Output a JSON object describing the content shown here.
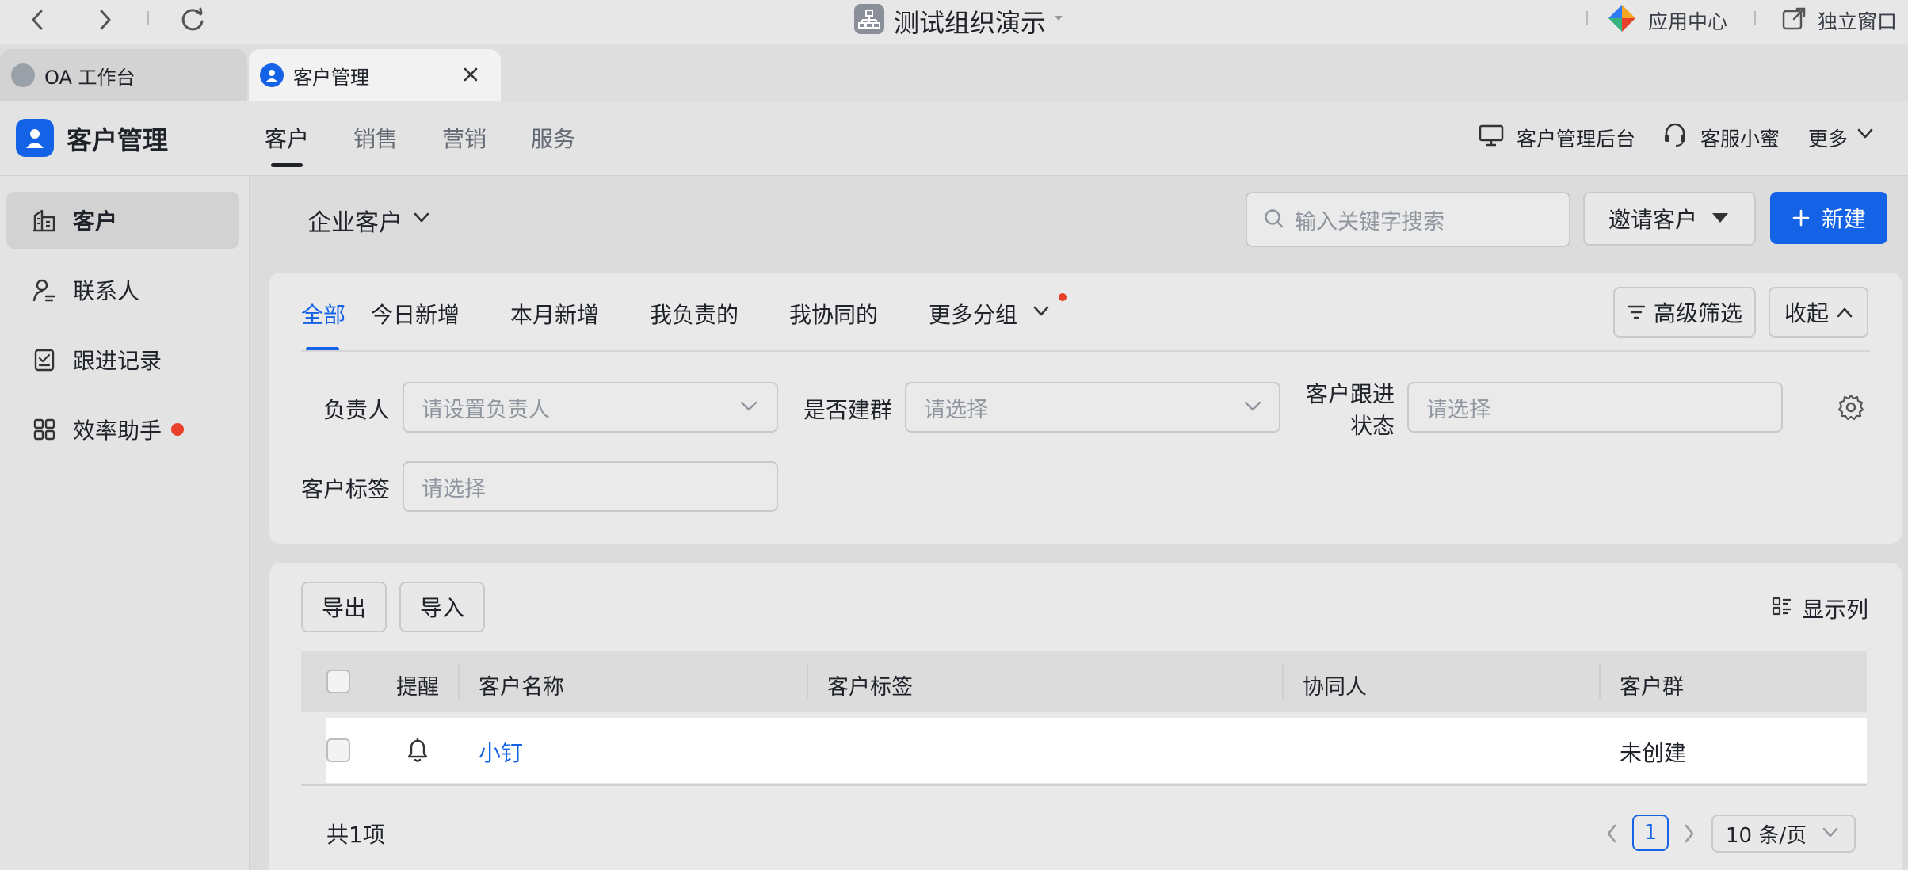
{
  "window": {
    "title": "测试组织演示",
    "app_center": "应用中心",
    "standalone": "独立窗口"
  },
  "tabs": [
    {
      "label": "OA 工作台"
    },
    {
      "label": "客户管理"
    }
  ],
  "app": {
    "name": "客户管理",
    "nav": [
      "客户",
      "销售",
      "营销",
      "服务"
    ],
    "admin": "客户管理后台",
    "service": "客服小蜜",
    "more": "更多"
  },
  "sidebar": {
    "items": [
      {
        "label": "客户",
        "icon": "building-icon"
      },
      {
        "label": "联系人",
        "icon": "contact-icon"
      },
      {
        "label": "跟进记录",
        "icon": "checklist-icon"
      },
      {
        "label": "效率助手",
        "icon": "grid-icon"
      }
    ]
  },
  "toolbar": {
    "customer_type": "企业客户",
    "search_placeholder": "输入关键字搜索",
    "invite": "邀请客户",
    "create": "新建"
  },
  "filters": {
    "tabs": [
      "全部",
      "今日新增",
      "本月新增",
      "我负责的",
      "我协同的",
      "更多分组"
    ],
    "advanced": "高级筛选",
    "collapse": "收起",
    "owner_label": "负责人",
    "owner_placeholder": "请设置负责人",
    "group_label": "是否建群",
    "group_placeholder": "请选择",
    "status_label_1": "客户跟进",
    "status_label_2": "状态",
    "status_placeholder": "请选择",
    "tag_label": "客户标签",
    "tag_placeholder": "请选择"
  },
  "table": {
    "export": "导出",
    "import": "导入",
    "columns_btn": "显示列",
    "headers": [
      "提醒",
      "客户名称",
      "客户标签",
      "协同人",
      "客户群"
    ],
    "rows": [
      {
        "name": "小钉",
        "tags": "",
        "collaborators": "",
        "group": "未创建"
      }
    ],
    "total": "共1项",
    "page": "1",
    "page_size": "10 条/页"
  },
  "colors": {
    "primary": "#1463e6",
    "badge": "#e8402a"
  }
}
